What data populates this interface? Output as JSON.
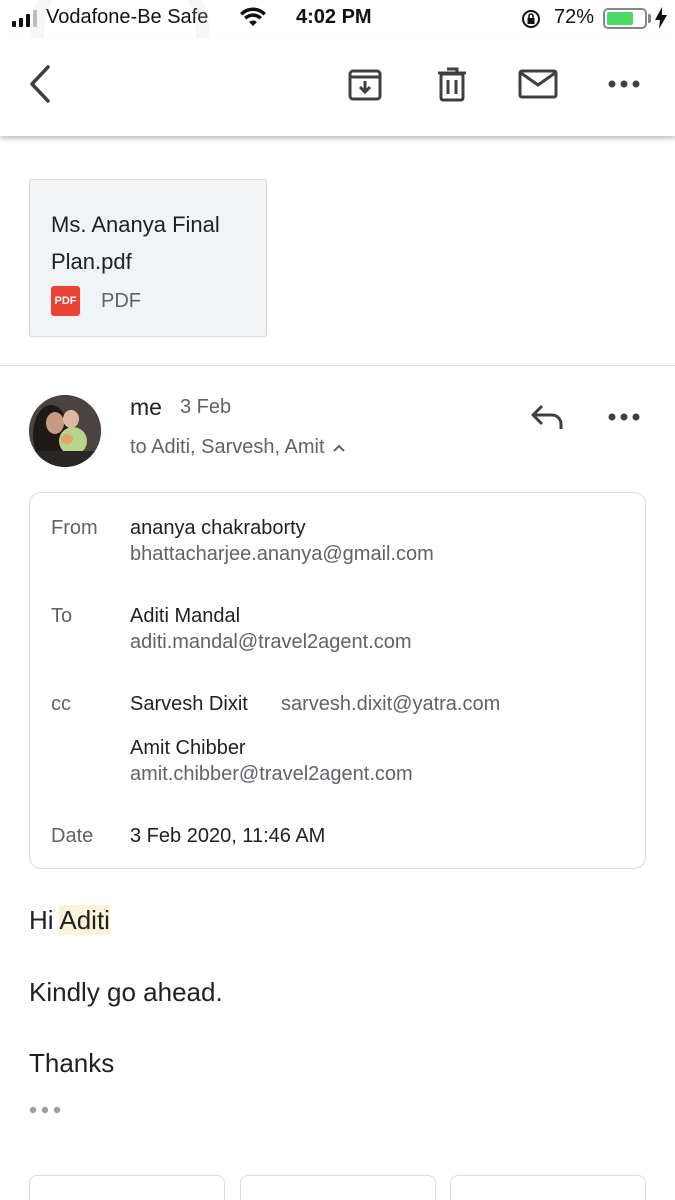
{
  "status_bar": {
    "carrier": "Vodafone-Be Safe",
    "time": "4:02 PM",
    "battery_percent": "72%",
    "battery_level": 0.72
  },
  "toolbar": {
    "icons": [
      "back-icon",
      "archive-icon",
      "delete-icon",
      "mail-icon",
      "more-icon"
    ]
  },
  "attachment": {
    "name": "Ms. Ananya Final Plan.pdf",
    "icon_label": "PDF",
    "type": "PDF"
  },
  "message": {
    "sender": "me",
    "date": "3 Feb",
    "recipients": "to Aditi, Sarvesh, Amit",
    "details": {
      "from_label": "From",
      "from_name": "ananya chakraborty",
      "from_email": "bhattacharjee.ananya@gmail.com",
      "to_label": "To",
      "to_name": "Aditi Mandal",
      "to_email": "aditi.mandal@travel2agent.com",
      "cc_label": "cc",
      "cc1_name": "Sarvesh Dixit",
      "cc1_email": "sarvesh.dixit@yatra.com",
      "cc2_name": "Amit Chibber",
      "cc2_email": "amit.chibber@travel2agent.com",
      "date_label": "Date",
      "date_value": "3 Feb 2020, 11:46 AM"
    },
    "body": {
      "greeting": "Hi",
      "greeting_name": "Aditi",
      "line1": "Kindly go ahead.",
      "line2": "Thanks"
    }
  },
  "actions": {
    "reply": "",
    "reply_all": "",
    "forward": ""
  },
  "colors": {
    "accent_green": "#4cd964",
    "pdf_red": "#ea4335",
    "highlight": "#fdf3d6"
  }
}
